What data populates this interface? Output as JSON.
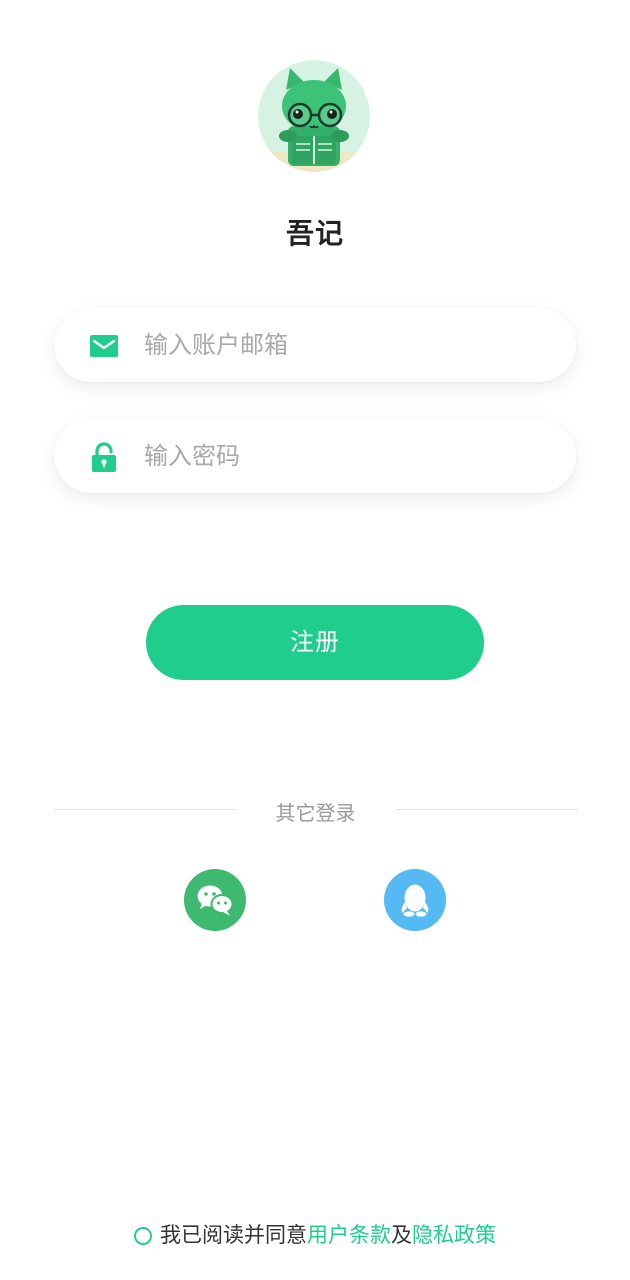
{
  "app": {
    "title": "吾记",
    "avatar_icon": "cat-reading-icon"
  },
  "form": {
    "email": {
      "placeholder": "输入账户邮箱",
      "value": "",
      "icon": "mail-icon"
    },
    "password": {
      "placeholder": "输入密码",
      "value": "",
      "icon": "lock-icon"
    },
    "submit_label": "注册"
  },
  "other_login": {
    "label": "其它登录",
    "providers": [
      {
        "name": "wechat",
        "icon": "wechat-icon",
        "color": "#3dba6f"
      },
      {
        "name": "qq",
        "icon": "qq-icon",
        "color": "#55b9f3"
      }
    ]
  },
  "agreement": {
    "prefix": "我已阅读并同意",
    "terms_link": "用户条款",
    "joiner": "及",
    "privacy_link": "隐私政策",
    "checked": false
  },
  "colors": {
    "accent": "#1fcd8c",
    "placeholder": "#a8a8a8",
    "divider": "#e2e2e2"
  }
}
